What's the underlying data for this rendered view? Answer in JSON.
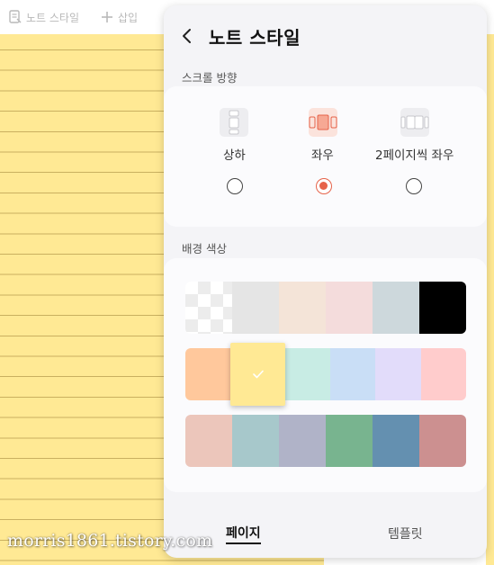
{
  "toolbar": {
    "note_style_label": "노트 스타일",
    "insert_label": "삽입"
  },
  "panel": {
    "title": "노트 스타일",
    "scroll_section": {
      "label": "스크롤 방향",
      "options": [
        {
          "label": "상하",
          "icon": "vertical-scroll-icon",
          "selected": false
        },
        {
          "label": "좌우",
          "icon": "horizontal-scroll-icon",
          "selected": true
        },
        {
          "label": "2페이지씩 좌우",
          "icon": "two-page-scroll-icon",
          "selected": false
        }
      ]
    },
    "background_section": {
      "label": "배경 색상",
      "rows": [
        [
          "transparent",
          "#e5e5e5",
          "#f4e4d8",
          "#f4dcdc",
          "#cdd8dc",
          "#000000"
        ],
        [
          "#ffc89c",
          "#ffe994",
          "#c8ece4",
          "#c9def6",
          "#e2dcfa",
          "#ffcccc"
        ],
        [
          "#ecc6bb",
          "#a7c8cb",
          "#b0b3c8",
          "#78b48f",
          "#6490b0",
          "#cc9090"
        ]
      ],
      "selected_color": "#ffe994"
    },
    "tabs": [
      {
        "label": "페이지",
        "active": true
      },
      {
        "label": "템플릿",
        "active": false
      }
    ],
    "accent_color": "#e6634a"
  },
  "watermark": "morris1861.tistory.com"
}
